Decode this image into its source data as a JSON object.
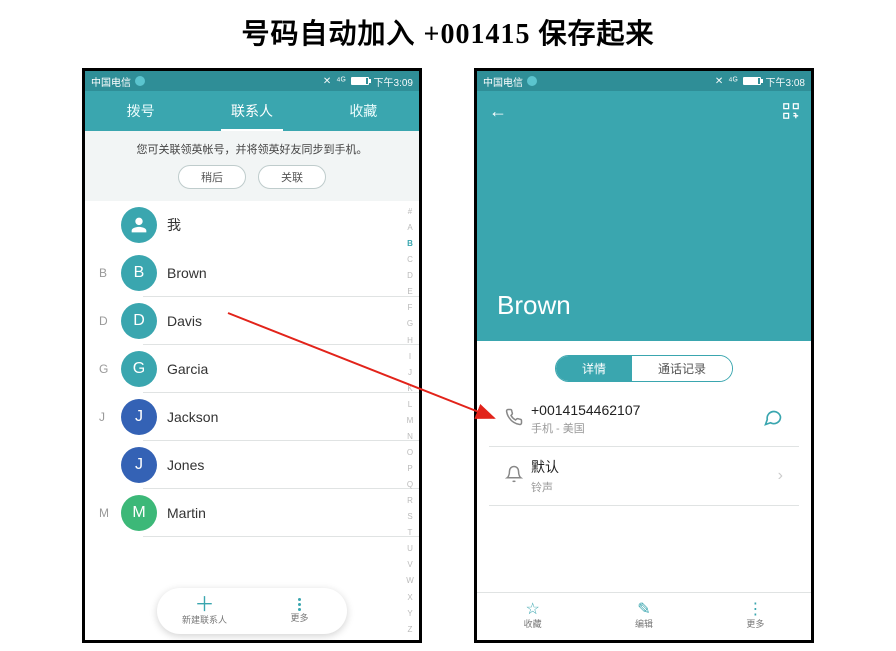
{
  "heading": "号码自动加入 +001415 保存起来",
  "status": {
    "carrier": "中国电信",
    "time_left": "下午3:09",
    "time_right": "下午3:08"
  },
  "tabs": {
    "dial": "拨号",
    "contacts": "联系人",
    "fav": "收藏"
  },
  "banner": {
    "msg": "您可关联领英帐号，并将领英好友同步到手机。",
    "later": "稍后",
    "link": "关联"
  },
  "contacts": {
    "me": "我",
    "rows": [
      {
        "sect": "B",
        "letter": "B",
        "name": "Brown",
        "cls": "blue"
      },
      {
        "sect": "D",
        "letter": "D",
        "name": "Davis",
        "cls": "blue"
      },
      {
        "sect": "G",
        "letter": "G",
        "name": "Garcia",
        "cls": "blue"
      },
      {
        "sect": "J",
        "letter": "J",
        "name": "Jackson",
        "cls": "dblue"
      },
      {
        "sect": "",
        "letter": "J",
        "name": "Jones",
        "cls": "dblue"
      },
      {
        "sect": "M",
        "letter": "M",
        "name": "Martin",
        "cls": "green"
      }
    ]
  },
  "alpha": [
    "#",
    "A",
    "B",
    "C",
    "D",
    "E",
    "F",
    "G",
    "H",
    "I",
    "J",
    "K",
    "L",
    "M",
    "N",
    "O",
    "P",
    "Q",
    "R",
    "S",
    "T",
    "U",
    "V",
    "W",
    "X",
    "Y",
    "Z"
  ],
  "alpha_on": "B",
  "fab": {
    "new": "新建联系人",
    "more": "更多"
  },
  "detail": {
    "name": "Brown",
    "seg_on": "详情",
    "seg_off": "通话记录",
    "phone": "+0014154462107",
    "phone_type": "手机 - 美国",
    "ring_title": "默认",
    "ring_sub": "铃声",
    "bottom": {
      "fav": "收藏",
      "edit": "编辑",
      "more": "更多"
    }
  }
}
